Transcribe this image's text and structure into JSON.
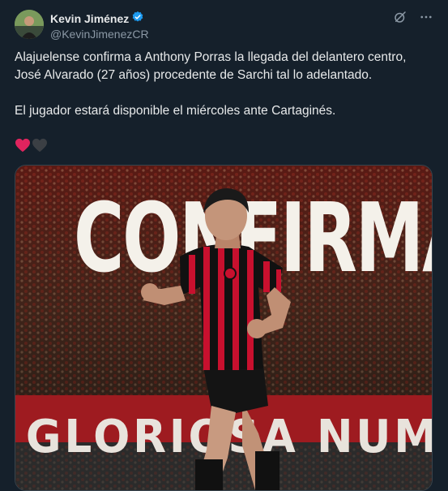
{
  "author": {
    "name": "Kevin Jiménez",
    "handle": "@KevinJimenezCR",
    "verified_color": "#1d9bf0"
  },
  "tweet": {
    "line1": "Alajuelense confirma a Anthony Porras la llegada del delantero centro, José Alvarado (27 años) procedente de Sarchi tal lo adelantado.",
    "line2": "El jugador estará disponible el miércoles ante Cartaginés."
  },
  "reactions": {
    "heart_red": "#e0245e",
    "heart_dark": "#2f3336"
  },
  "media": {
    "headline": "CONFIRMADO",
    "banner": "GLORIOSA NUMF",
    "jersey_red": "#c8102e",
    "jersey_black": "#111111"
  },
  "icons": {
    "grok": "grok-icon",
    "more": "more-icon",
    "verified": "verified-badge-icon"
  }
}
